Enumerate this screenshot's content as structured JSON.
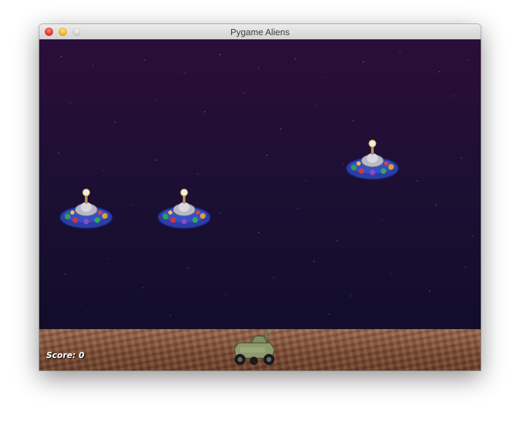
{
  "window": {
    "title": "Pygame Aliens"
  },
  "hud": {
    "score_label": "Score: 0",
    "score": 0
  },
  "entities": {
    "aliens": [
      {
        "name": "alien-1",
        "icon": "ufo-sprite"
      },
      {
        "name": "alien-2",
        "icon": "ufo-sprite"
      },
      {
        "name": "alien-3",
        "icon": "ufo-sprite"
      }
    ],
    "player": {
      "name": "player-tank",
      "icon": "tank-sprite"
    }
  },
  "colors": {
    "sky_top": "#2b0e3a",
    "sky_bottom": "#0e0c27",
    "ground": "#8a5a3e",
    "ufo_body": "#2a3a9a"
  }
}
